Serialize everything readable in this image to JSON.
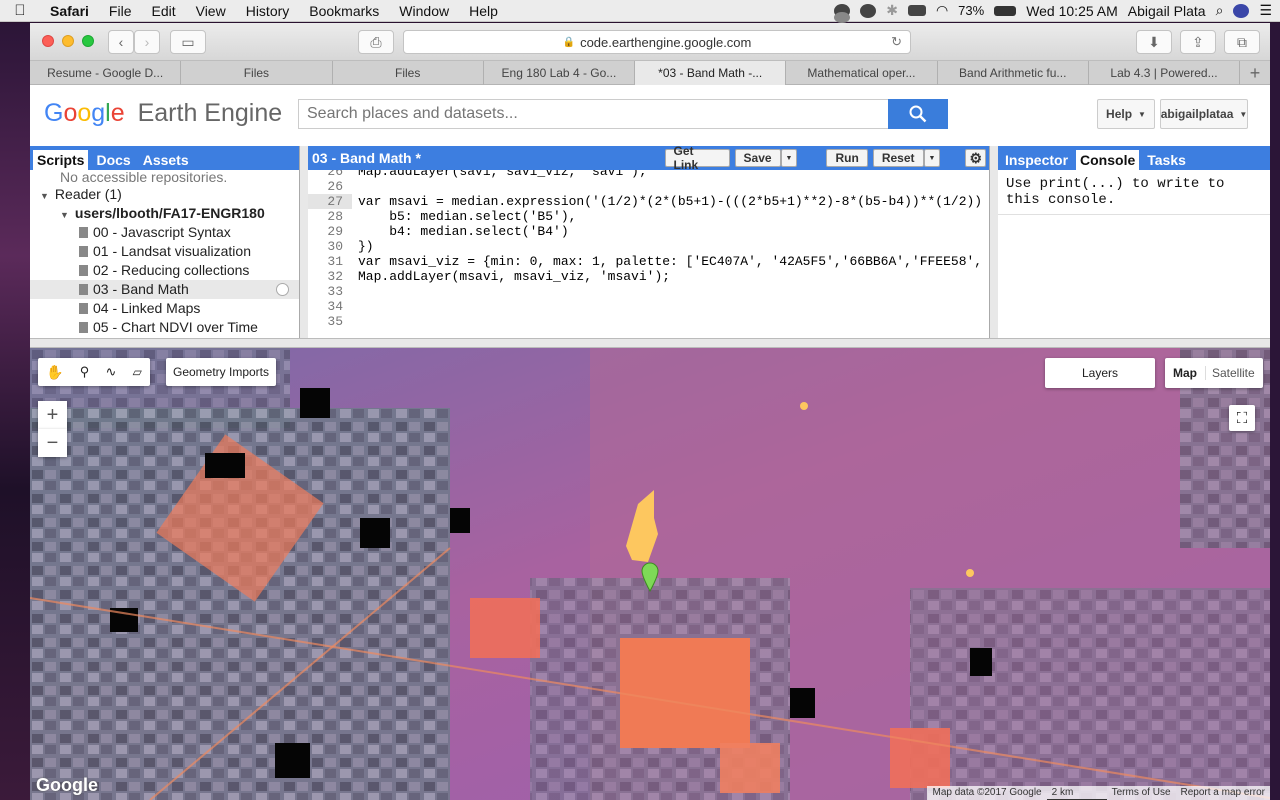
{
  "menubar": {
    "app": "Safari",
    "items": [
      "File",
      "Edit",
      "View",
      "History",
      "Bookmarks",
      "Window",
      "Help"
    ],
    "battery": "73%",
    "clock": "Wed 10:25 AM",
    "user": "Abigail Plata"
  },
  "browser": {
    "url": "code.earthengine.google.com",
    "tabs": [
      "Resume - Google D...",
      "Files",
      "Files",
      "Eng 180 Lab 4 - Go...",
      "*03 - Band Math -...",
      "Mathematical oper...",
      "Band Arithmetic fu...",
      "Lab 4.3 | Powered..."
    ],
    "active_tab": 4,
    "new_tab": "+"
  },
  "gee": {
    "logo_google": [
      "G",
      "o",
      "o",
      "g",
      "l",
      "e"
    ],
    "logo_rest": "Earth Engine",
    "search_placeholder": "Search places and datasets...",
    "help_label": "Help",
    "user_label": "abigailplataa"
  },
  "left_panel": {
    "tabs": [
      "Scripts",
      "Docs",
      "Assets"
    ],
    "note": "No accessible repositories.",
    "tree": {
      "reader": "Reader  (1)",
      "repo": "users/lbooth/FA17-ENGR180",
      "files": [
        "00 - Javascript Syntax",
        "01 - Landsat visualization",
        "02 - Reducing collections",
        "03 - Band Math",
        "04 - Linked Maps",
        "05 - Chart NDVI over Time"
      ],
      "selected": 3
    }
  },
  "editor": {
    "title": "03 - Band Math *",
    "buttons": {
      "get_link": "Get Link",
      "save": "Save",
      "run": "Run",
      "reset": "Reset"
    },
    "lines": [
      {
        "n": "26",
        "text": "Map.addLayer(savi, savi_viz, 'savi');"
      },
      {
        "n": "27",
        "text": "var msavi = median.expression('(1/2)*(2*(b5+1)-(((2*b5+1)**2)-8*(b5-b4))**(1/2))"
      },
      {
        "n": "28",
        "text": "    b5: median.select('B5'),"
      },
      {
        "n": "29",
        "text": "    b4: median.select('B4')"
      },
      {
        "n": "30",
        "text": "})"
      },
      {
        "n": "31",
        "text": "var msavi_viz = {min: 0, max: 1, palette: ['EC407A', '42A5F5','66BB6A','FFEE58',"
      },
      {
        "n": "32",
        "text": "Map.addLayer(msavi, msavi_viz, 'msavi');"
      },
      {
        "n": "33",
        "text": ""
      },
      {
        "n": "34",
        "text": ""
      },
      {
        "n": "35",
        "text": ""
      }
    ]
  },
  "right_panel": {
    "tabs": [
      "Inspector",
      "Console",
      "Tasks"
    ],
    "active": 1,
    "console_text": "Use print(...) to write to this console."
  },
  "map": {
    "geometry_imports": "Geometry Imports",
    "layers": "Layers",
    "map_type": [
      "Map",
      "Satellite"
    ],
    "zoom_in": "+",
    "zoom_out": "−",
    "watermark": "Google",
    "attribution": [
      "Map data ©2017 Google",
      "2 km",
      "Terms of Use",
      "Report a map error"
    ],
    "marker_color": "#7ed957"
  }
}
